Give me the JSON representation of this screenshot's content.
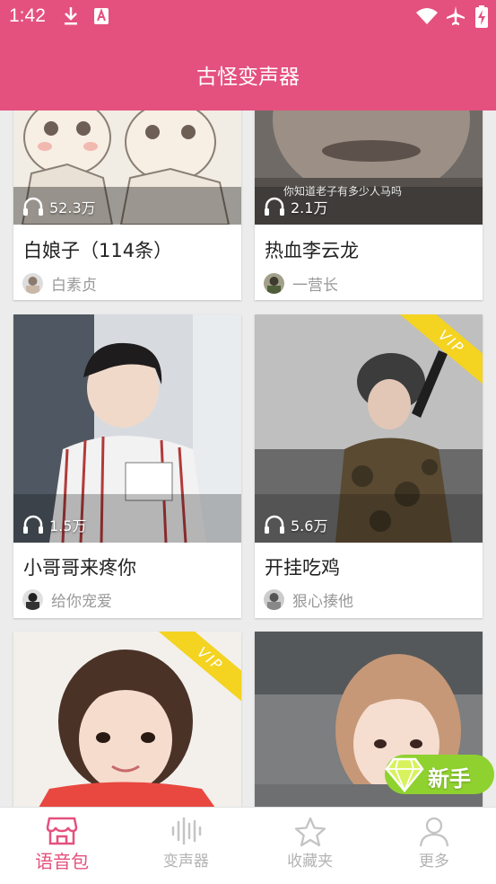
{
  "status_bar": {
    "time": "1:42"
  },
  "header": {
    "title": "古怪变声器"
  },
  "cards": [
    {
      "title": "白娘子（114条）",
      "plays": "52.3万",
      "author": "白素贞",
      "vip": false
    },
    {
      "title": "热血李云龙",
      "plays": "2.1万",
      "author": "一营长",
      "vip": false
    },
    {
      "title": "小哥哥来疼你",
      "plays": "1.5万",
      "author": "给你宠爱",
      "vip": false
    },
    {
      "title": "开挂吃鸡",
      "plays": "5.6万",
      "author": "狠心揍他",
      "vip": true
    },
    {
      "title": "",
      "plays": "",
      "author": "",
      "vip": true
    },
    {
      "title": "",
      "plays": "",
      "author": "",
      "vip": false
    }
  ],
  "cover_caption": "你知道老子有多少人马吗",
  "vip_label": "VIP",
  "newbie_badge": {
    "label": "新手"
  },
  "bottom_nav": [
    {
      "label": "语音包",
      "icon": "shop-icon",
      "active": true
    },
    {
      "label": "变声器",
      "icon": "soundwave-icon",
      "active": false
    },
    {
      "label": "收藏夹",
      "icon": "star-icon",
      "active": false
    },
    {
      "label": "更多",
      "icon": "person-icon",
      "active": false
    }
  ],
  "colors": {
    "brand": "#e4517e",
    "vip": "#f4d321",
    "badge": "#8fd12e"
  }
}
